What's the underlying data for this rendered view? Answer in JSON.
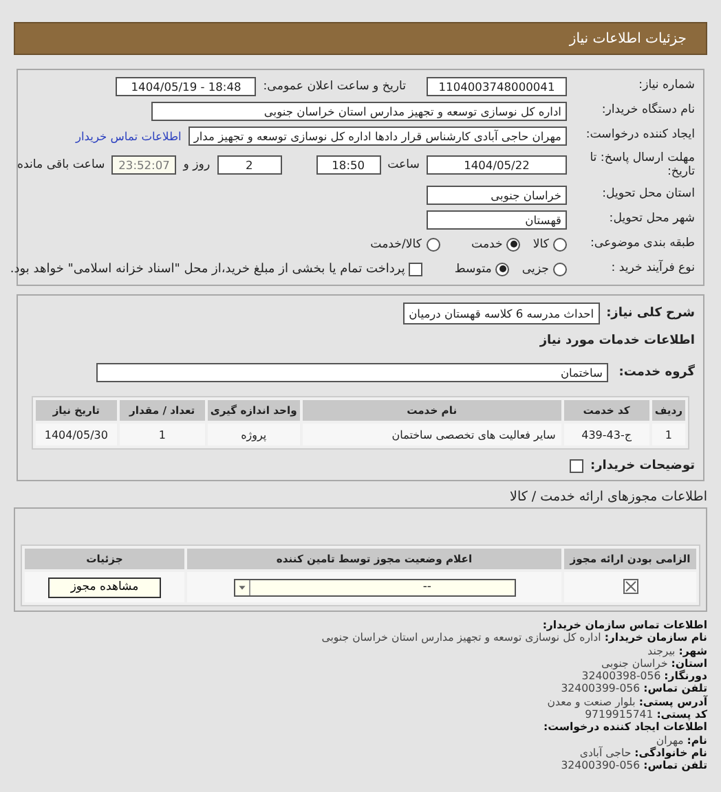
{
  "header": {
    "title": "جزئیات اطلاعات نیاز"
  },
  "need_number": {
    "label": "شماره نیاز:",
    "value": "1104003748000041"
  },
  "announce": {
    "label": "تاریخ و ساعت اعلان عمومی:",
    "value": "1404/05/19 - 18:48"
  },
  "buyer_org": {
    "label": "نام دستگاه خریدار:",
    "value": "اداره کل نوسازی  توسعه و تجهیز مدارس استان خراسان جنوبی"
  },
  "requester": {
    "label": "ایجاد کننده درخواست:",
    "value": "مهران حاجی آبادی کارشناس قرار دادها اداره کل نوسازی  توسعه و تجهیز مدار",
    "link": "اطلاعات تماس خریدار"
  },
  "deadline": {
    "label": "مهلت ارسال پاسخ: تا تاریخ:",
    "date": "1404/05/22",
    "time_label": "ساعت",
    "time": "18:50",
    "days": "2",
    "days_label": "روز و",
    "remaining": "23:52:07",
    "remaining_label": "ساعت باقی مانده"
  },
  "province": {
    "label": "استان محل تحویل:",
    "value": "خراسان جنوبی"
  },
  "city": {
    "label": "شهر محل تحویل:",
    "value": "قهستان"
  },
  "category": {
    "label": "طبقه بندی موضوعی:",
    "options": [
      {
        "label": "کالا",
        "selected": false
      },
      {
        "label": "خدمت",
        "selected": true
      },
      {
        "label": "کالا/خدمت",
        "selected": false
      }
    ]
  },
  "process": {
    "label": "نوع فرآیند خرید :",
    "options": [
      {
        "label": "جزیی",
        "selected": false
      },
      {
        "label": "متوسط",
        "selected": true
      }
    ],
    "installment": {
      "checked": false,
      "text": "پرداخت تمام یا بخشی از مبلغ خرید،از محل \"اسناد خزانه اسلامی\" خواهد بود."
    }
  },
  "summary": {
    "label": "شرح کلی نیاز:",
    "value": "احداث مدرسه 6 کلاسه قهستان درمیان"
  },
  "services_title": "اطلاعات خدمات مورد نیاز",
  "service_group": {
    "label": "گروه خدمت:",
    "value": "ساختمان"
  },
  "services_table": {
    "columns": [
      "ردیف",
      "کد خدمت",
      "نام خدمت",
      "واحد اندازه گیری",
      "تعداد / مقدار",
      "تاریخ نیاز"
    ],
    "rows": [
      [
        "1",
        "ج-43-439",
        "سایر فعالیت های تخصصی ساختمان",
        "پروژه",
        "1",
        "1404/05/30"
      ]
    ]
  },
  "buyer_notes": {
    "label": "توضیحات خریدار:",
    "checked": false
  },
  "permits": {
    "title": "اطلاعات مجوزهای ارائه خدمت / کالا",
    "columns": [
      "الزامی بودن ارائه مجوز",
      "اعلام وضعیت مجوز توسط تامین کننده",
      "جزئیات"
    ],
    "rows": [
      {
        "required": true,
        "status": "--",
        "button": "مشاهده مجوز"
      }
    ]
  },
  "contact": [
    {
      "kind": "heading",
      "label": "اطلاعات تماس سازمان خریدار:"
    },
    {
      "kind": "line",
      "label": "نام سازمان خریدار:",
      "value": "اداره کل نوسازی توسعه و تجهیز مدارس استان خراسان جنوبی"
    },
    {
      "kind": "line",
      "label": "شهر:",
      "value": "بیرجند"
    },
    {
      "kind": "line",
      "label": "استان:",
      "value": "خراسان جنوبی"
    },
    {
      "kind": "line",
      "label": "دورنگار:",
      "value": "32400398-056"
    },
    {
      "kind": "line",
      "label": "تلفن تماس:",
      "value": "32400399-056"
    },
    {
      "kind": "line",
      "label": "آدرس پستی:",
      "value": "بلوار صنعت و معدن"
    },
    {
      "kind": "line",
      "label": "کد پستی:",
      "value": "9719915741"
    },
    {
      "kind": "heading",
      "label": "اطلاعات ایجاد کننده درخواست:"
    },
    {
      "kind": "line",
      "label": "نام:",
      "value": "مهران"
    },
    {
      "kind": "line",
      "label": "نام خانوادگی:",
      "value": "حاجی آبادی"
    },
    {
      "kind": "line",
      "label": "تلفن تماس:",
      "value": "32400390-056"
    }
  ]
}
